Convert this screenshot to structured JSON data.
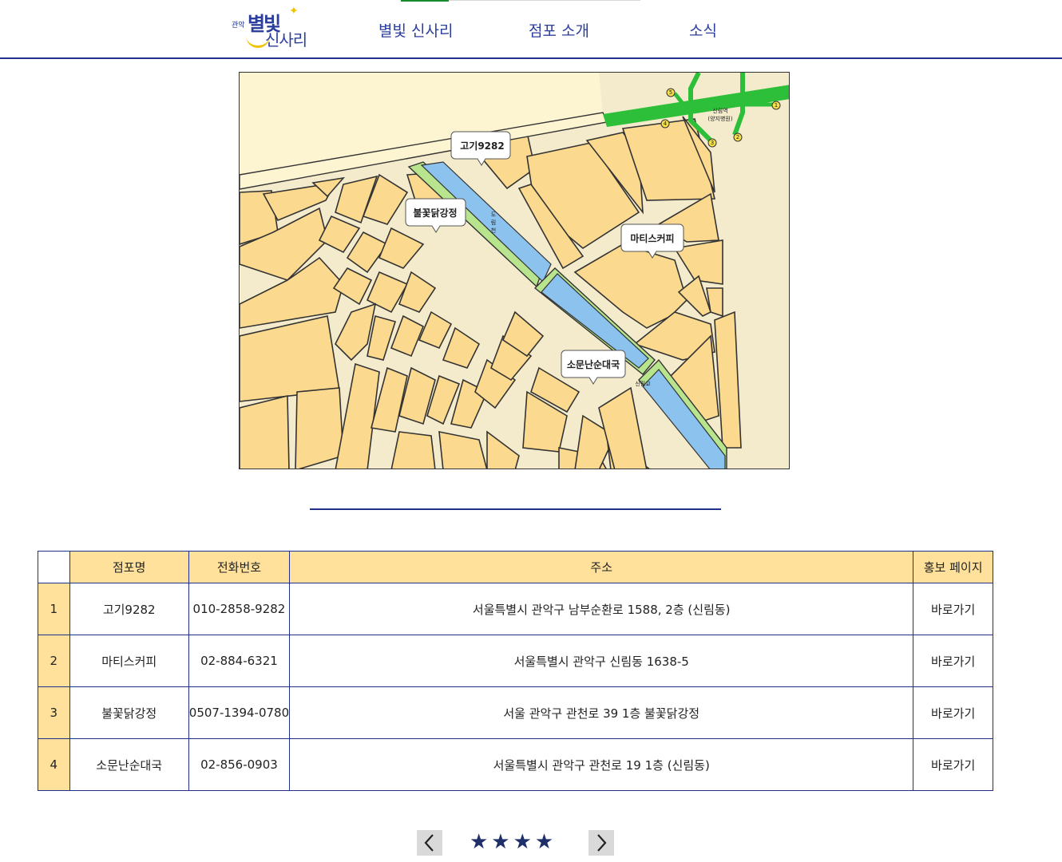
{
  "header": {
    "logo": {
      "small": "관악",
      "big1": "별빛",
      "big2": "신사리"
    },
    "nav": [
      {
        "label": "별빛 신사리"
      },
      {
        "label": "점포 소개"
      },
      {
        "label": "소식"
      }
    ]
  },
  "map": {
    "callouts": [
      {
        "label": "고기9282"
      },
      {
        "label": "불꽃닭강정"
      },
      {
        "label": "마티스커피"
      },
      {
        "label": "소문난순대국"
      }
    ],
    "station": {
      "name": "신림역",
      "sub": "(양지병원)"
    },
    "exits": [
      "1",
      "2",
      "3",
      "4",
      "5"
    ],
    "park_label": [
      "도",
      "림",
      "천"
    ],
    "bridge_label": "신림교"
  },
  "table": {
    "headers": [
      "점포명",
      "전화번호",
      "주소",
      "홍보 페이지"
    ],
    "rows": [
      {
        "num": "1",
        "name": "고기9282",
        "phone": "010-2858-9282",
        "address": "서울특별시 관악구 남부순환로 1588, 2층 (신림동)",
        "link": "바로가기"
      },
      {
        "num": "2",
        "name": "마티스커피",
        "phone": "02-884-6321",
        "address": "서울특별시 관악구 신림동 1638-5",
        "link": "바로가기"
      },
      {
        "num": "3",
        "name": "불꽃닭강정",
        "phone": "0507-1394-0780",
        "address": "서울 관악구 관천로 39 1층 불꽃닭강정",
        "link": "바로가기"
      },
      {
        "num": "4",
        "name": "소문난순대국",
        "phone": "02-856-0903",
        "address": "서울특별시 관악구 관천로 19 1층 (신림동)",
        "link": "바로가기"
      }
    ]
  },
  "pager": {
    "prev_icon": "chevron-left-icon",
    "next_icon": "chevron-right-icon",
    "stars": "★★★★"
  },
  "colors": {
    "brand_blue": "#1f2f8a",
    "header_fill": "#ffe19b",
    "map_block": "#fbd98f",
    "map_block_light": "#fde9a6",
    "stream": "#8cc3ee",
    "park": "#b7e48c",
    "subway": "#2dbf3a"
  }
}
